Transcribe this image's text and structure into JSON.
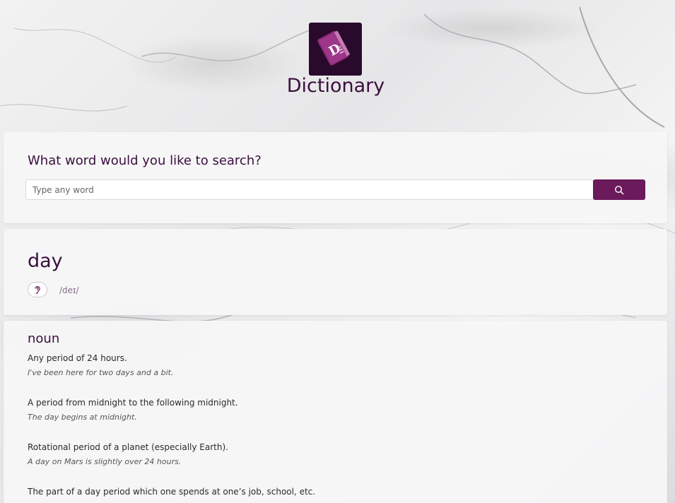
{
  "app": {
    "title": "Dictionary",
    "logo_letter": "D",
    "colors": {
      "accent": "#6b1a5c",
      "logo_bg": "#2a0a2c",
      "title": "#3a0f3e"
    }
  },
  "search": {
    "heading": "What word would you like to search?",
    "placeholder": "Type any word",
    "value": "",
    "button_icon": "search-icon"
  },
  "result": {
    "word": "day",
    "phonetic": "/deɪ/",
    "audio_icon": "ear-icon"
  },
  "meanings": {
    "part_of_speech": "noun",
    "definitions": [
      {
        "definition": "Any period of 24 hours.",
        "example": "I've been here for two days and a bit."
      },
      {
        "definition": "A period from midnight to the following midnight.",
        "example": "The day begins at midnight."
      },
      {
        "definition": "Rotational period of a planet (especially Earth).",
        "example": "A day on Mars is slightly over 24 hours."
      },
      {
        "definition": "The part of a day period which one spends at one’s job, school, etc.",
        "example": ""
      }
    ]
  }
}
